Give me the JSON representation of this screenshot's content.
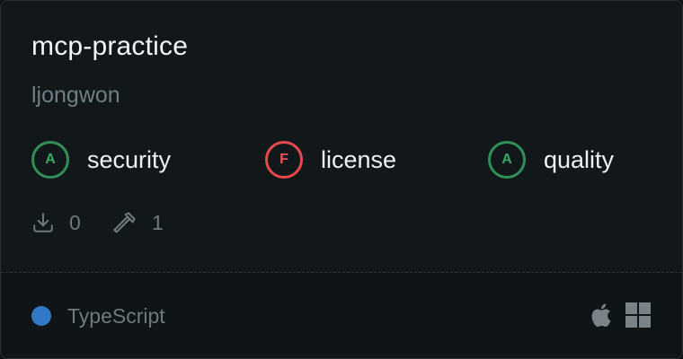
{
  "server": {
    "name": "mcp-practice",
    "author": "ljongwon"
  },
  "grades": [
    {
      "grade": "A",
      "label": "security",
      "status_color": "#2f8f57"
    },
    {
      "grade": "F",
      "label": "license",
      "status_color": "#e5484d"
    },
    {
      "grade": "A",
      "label": "quality",
      "status_color": "#2f8f57"
    }
  ],
  "stats": {
    "downloads": "0",
    "tools": "1",
    "downloads_icon": "download-icon",
    "tools_icon": "hammer-icon"
  },
  "language": {
    "name": "TypeScript",
    "color": "#3178c6"
  },
  "platforms": [
    "apple-icon",
    "windows-icon"
  ]
}
